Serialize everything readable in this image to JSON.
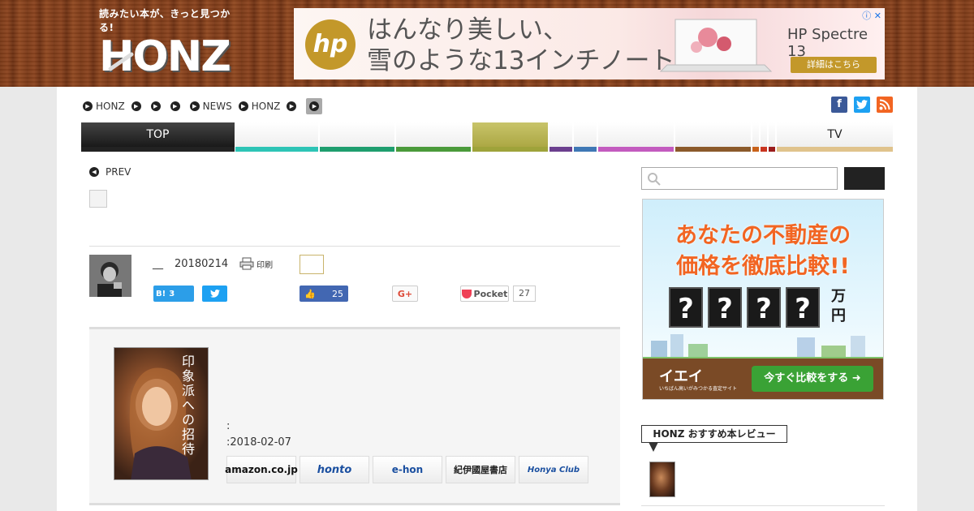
{
  "header": {
    "tagline": "読みたい本が、きっと見つかる!",
    "logo_text": "HONZ"
  },
  "ad": {
    "brand": "hp",
    "headline_line1": "はんなり美しい、",
    "headline_line2": "雪のような13インチノート",
    "product": "HP Spectre 13",
    "cta": "詳細はこちら",
    "close": "ⓘ ✕"
  },
  "breadcrumb": {
    "items": [
      "HONZ",
      "",
      "",
      "",
      "NEWS",
      "HONZ",
      "",
      ""
    ]
  },
  "social_top": [
    {
      "name": "facebook",
      "glyph": "f",
      "color": "#3b5998"
    },
    {
      "name": "twitter",
      "glyph": "t",
      "color": "#1da1f2"
    },
    {
      "name": "rss",
      "glyph": "r",
      "color": "#f26522"
    }
  ],
  "categories": [
    {
      "label": "TOP",
      "bar": "#222222"
    },
    {
      "label": "",
      "bar": "#2ec4b6"
    },
    {
      "label": "",
      "bar": "#1e9e6e"
    },
    {
      "label": "",
      "bar": "#4a9a3a"
    },
    {
      "label": "",
      "bar": "#9ea33a"
    },
    {
      "label": "",
      "bar": "#6b3f8e"
    },
    {
      "label": "",
      "bar": "#3f78b5"
    },
    {
      "label": "",
      "bar": "#c35bbf"
    },
    {
      "label": "",
      "bar": "#8b5a2b"
    },
    {
      "label": "",
      "bar": "#c8621a"
    },
    {
      "label": "",
      "bar": "#c9341f"
    },
    {
      "label": "",
      "bar": "#9a1c1c"
    },
    {
      "label": "TV",
      "bar": "#e0c38c"
    }
  ],
  "article": {
    "prev_label": "PREV",
    "author_sep": "__",
    "date": "20180214",
    "print_label": "印刷"
  },
  "share": {
    "hatena_label": "B!",
    "hatena_count": "3",
    "like_count": "25",
    "gplus_label": "G+",
    "pocket_label": "Pocket",
    "pocket_count": "27"
  },
  "book": {
    "cover_title": "印象派への招待",
    "meta_line1": ":",
    "meta_line2": ":2018-02-07",
    "stores": [
      "amazon.co.jp",
      "honto",
      "e-hon",
      "紀伊國屋書店",
      "Honya Club"
    ]
  },
  "sidebar": {
    "search_placeholder": "",
    "ad_title_line1": "あなたの不動産の",
    "ad_title_line2": "価格を徹底比較!!",
    "ad_q": "?",
    "ad_unit": "万円",
    "ad_brand": "イエイ",
    "ad_brand_sub": "いちばん高いがみつかる査定サイト",
    "ad_cta": "今すぐ比較をする ➜",
    "recommend_label": "HONZ おすすめ本レビュー"
  }
}
